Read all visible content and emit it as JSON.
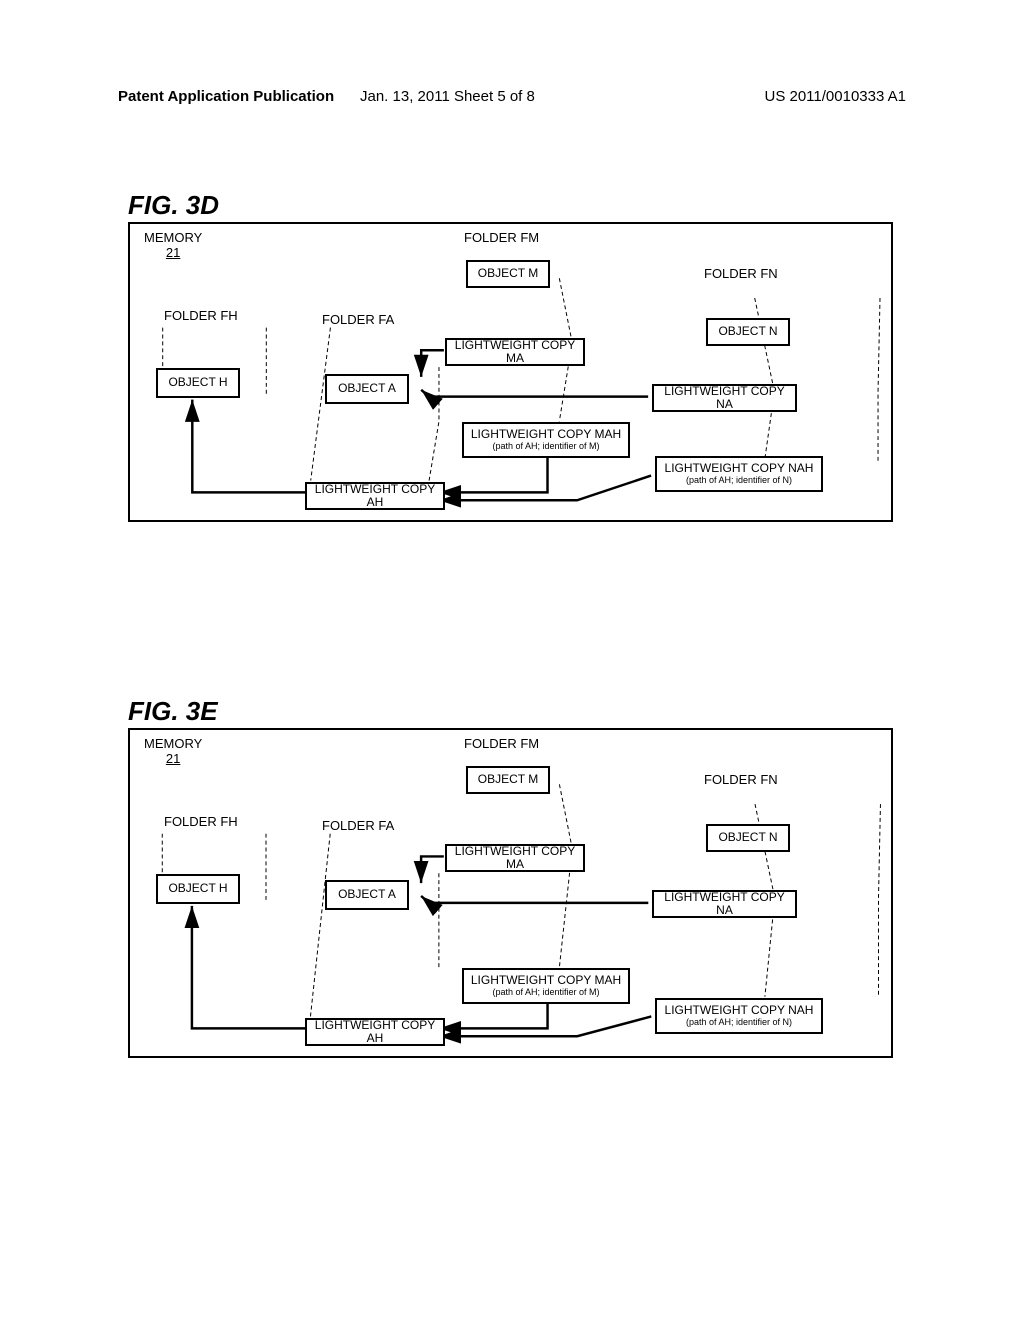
{
  "header": {
    "left": "Patent Application Publication",
    "center": "Jan. 13, 2011  Sheet 5 of 8",
    "right": "US 2011/0010333 A1"
  },
  "figD": {
    "label": "FIG. 3D",
    "memory": "MEMORY",
    "memoryNum": "21",
    "folderFH": "FOLDER FH",
    "folderFA": "FOLDER FA",
    "folderFM": "FOLDER FM",
    "folderFN": "FOLDER FN",
    "objH": "OBJECT H",
    "objA": "OBJECT A",
    "objM": "OBJECT M",
    "objN": "OBJECT N",
    "lcMA": "LIGHTWEIGHT COPY MA",
    "lcNA": "LIGHTWEIGHT COPY NA",
    "lcAH": "LIGHTWEIGHT COPY AH",
    "lcMAH": "LIGHTWEIGHT COPY MAH",
    "lcMAHsub": "(path of AH; identifier of M)",
    "lcNAH": "LIGHTWEIGHT COPY NAH",
    "lcNAHsub": "(path of AH; identifier of N)"
  },
  "figE": {
    "label": "FIG. 3E",
    "memory": "MEMORY",
    "memoryNum": "21",
    "folderFH": "FOLDER FH",
    "folderFA": "FOLDER FA",
    "folderFM": "FOLDER FM",
    "folderFN": "FOLDER FN",
    "objH": "OBJECT H",
    "objA": "OBJECT A",
    "objM": "OBJECT M",
    "objN": "OBJECT N",
    "lcMA": "LIGHTWEIGHT COPY MA",
    "lcNA": "LIGHTWEIGHT COPY NA",
    "lcAH": "LIGHTWEIGHT COPY AH",
    "lcMAH": "LIGHTWEIGHT COPY MAH",
    "lcMAHsub": "(path of AH; identifier of M)",
    "lcNAH": "LIGHTWEIGHT COPY NAH",
    "lcNAHsub": "(path of AH; identifier of N)"
  }
}
